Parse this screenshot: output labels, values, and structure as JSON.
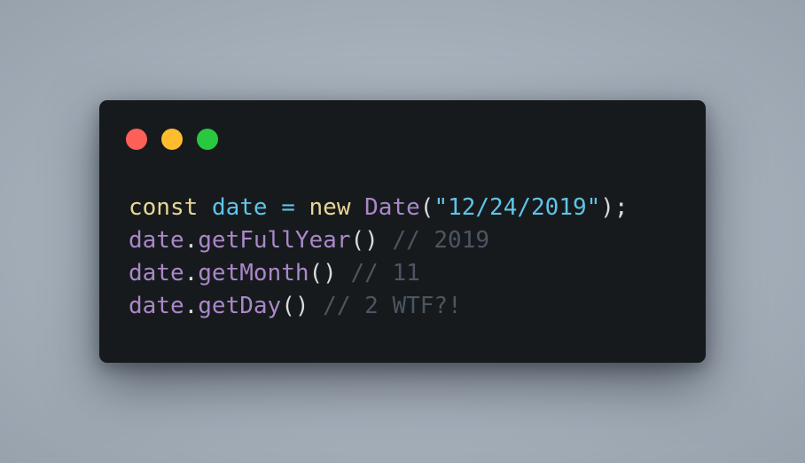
{
  "window": {
    "controls": [
      {
        "name": "close",
        "color": "#fe5f57"
      },
      {
        "name": "minimize",
        "color": "#febc2e"
      },
      {
        "name": "maximize",
        "color": "#28c840"
      }
    ]
  },
  "code": {
    "line1": {
      "keyword": "const",
      "variable": "date",
      "operator": "=",
      "new_keyword": "new",
      "class_name": "Date",
      "open_paren": "(",
      "string": "\"12/24/2019\"",
      "close": ");"
    },
    "line2": {
      "object": "date",
      "dot": ".",
      "method": "getFullYear",
      "parens": "()",
      "comment": "// 2019"
    },
    "line3": {
      "object": "date",
      "dot": ".",
      "method": "getMonth",
      "parens": "()",
      "comment": "// 11"
    },
    "line4": {
      "object": "date",
      "dot": ".",
      "method": "getDay",
      "parens": "()",
      "comment": "// 2 WTF?!"
    }
  },
  "colors": {
    "window_bg": "#171a1d",
    "keyword": "#e8d795",
    "variable": "#5fc4e8",
    "class": "#a988c9",
    "comment": "#4b5661"
  }
}
